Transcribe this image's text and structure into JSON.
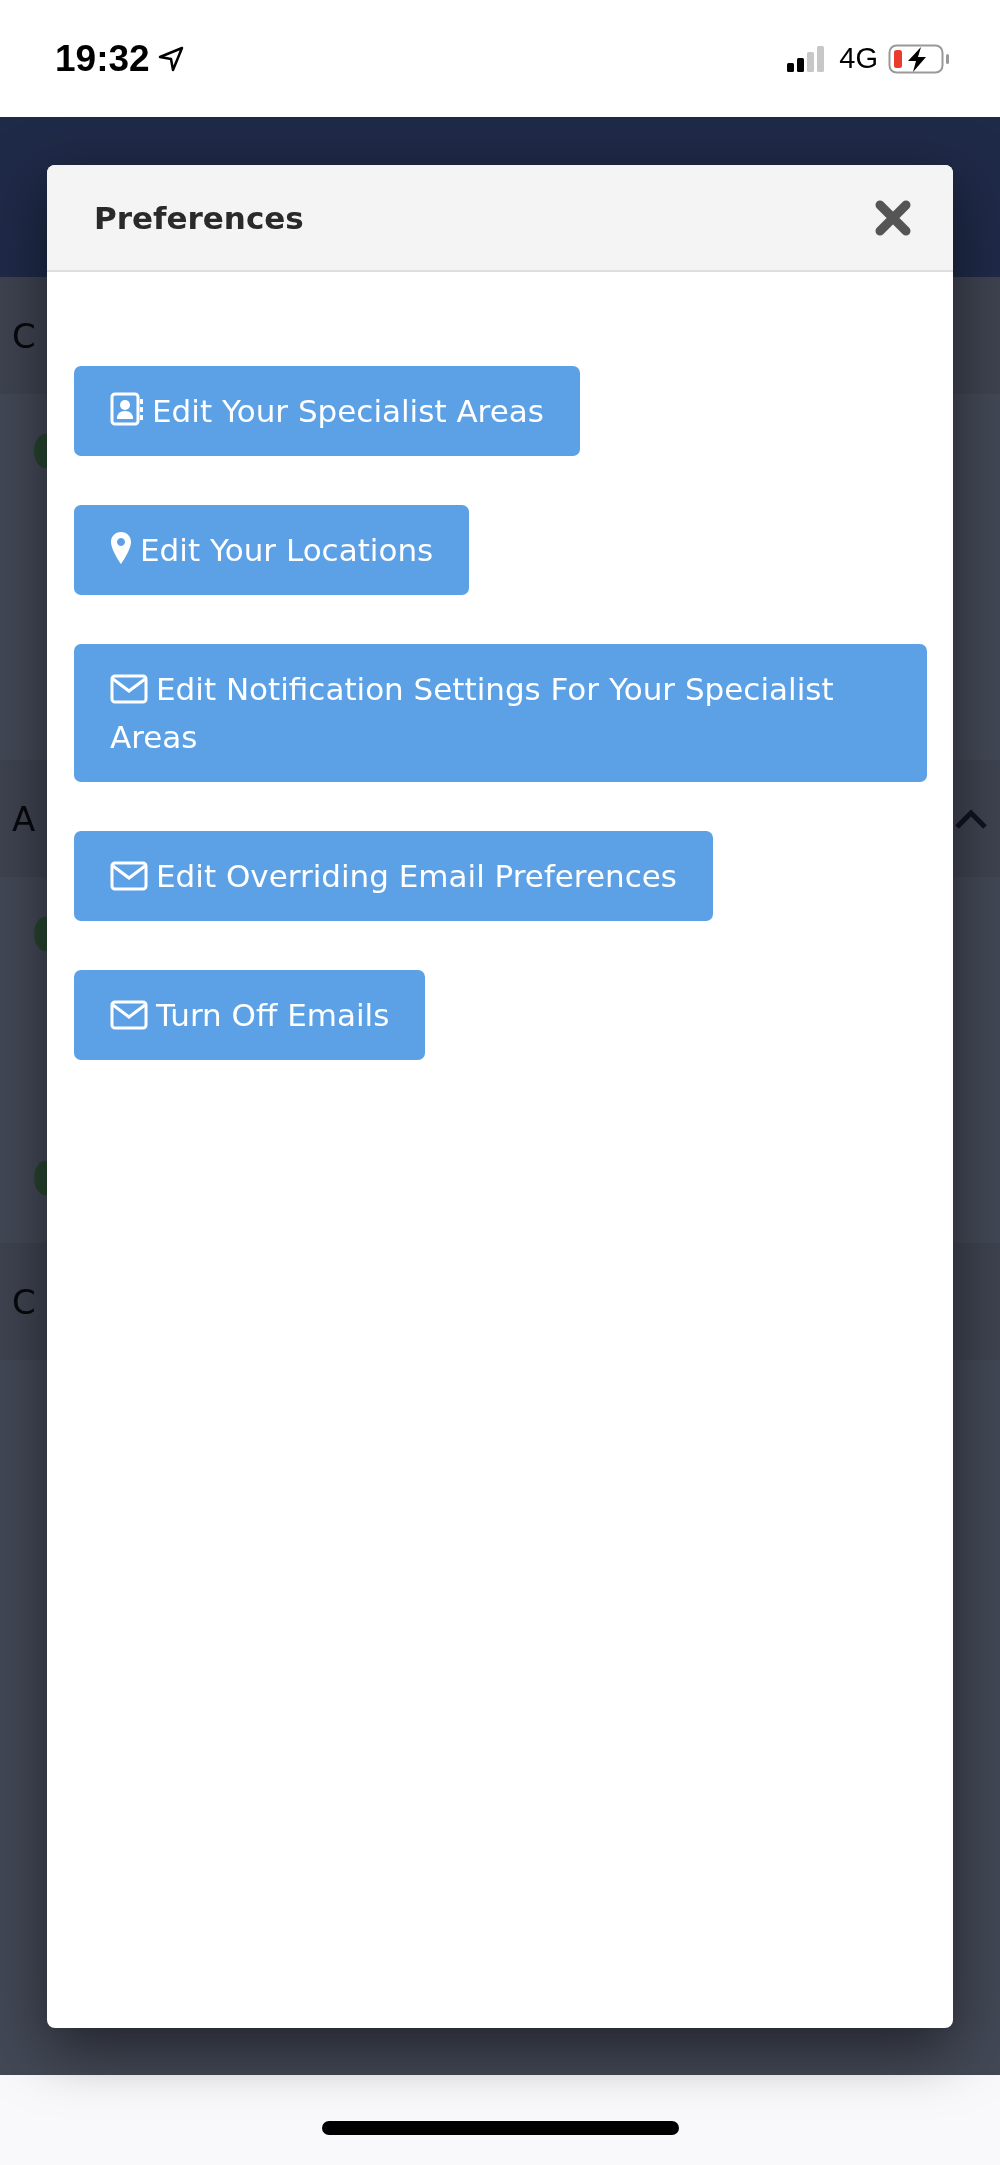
{
  "status_bar": {
    "time": "19:32",
    "network": "4G"
  },
  "background": {
    "sections": [
      {
        "heading": "C"
      },
      {
        "heading": "A",
        "toggle_icon": true
      },
      {
        "heading": "C"
      }
    ]
  },
  "modal": {
    "title": "Preferences",
    "buttons": [
      {
        "kind": "contact",
        "label": "Edit Your Specialist Areas"
      },
      {
        "kind": "marker",
        "label": "Edit Your Locations"
      },
      {
        "kind": "envelope",
        "label": "Edit Notification Settings For Your Specialist Areas"
      },
      {
        "kind": "envelope",
        "label": "Edit Overriding Email Preferences"
      },
      {
        "kind": "envelope",
        "label": "Turn Off Emails"
      }
    ]
  }
}
